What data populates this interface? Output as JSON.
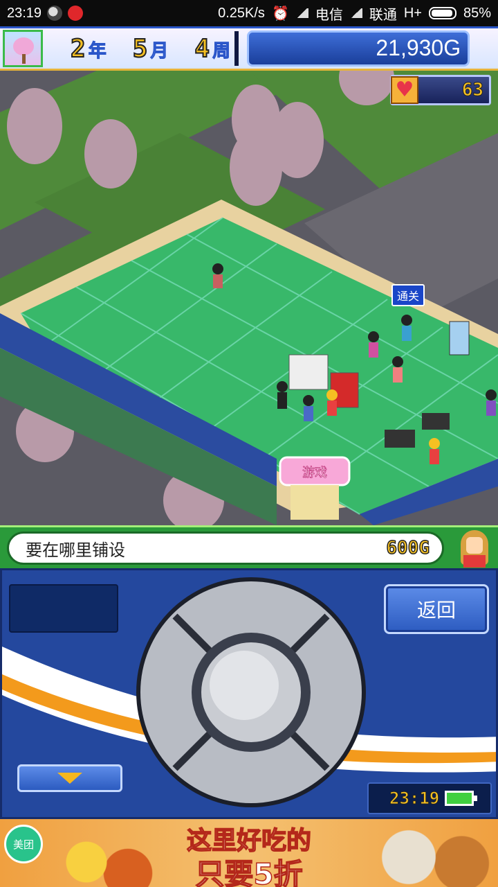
{
  "statusbar": {
    "time": "23:19",
    "speed": "0.25K/s",
    "carrier1": "电信",
    "carrier2": "联通",
    "network": "H+",
    "battery": "85%"
  },
  "hud": {
    "year_num": "2",
    "year_unit": "年",
    "month_num": "5",
    "month_unit": "月",
    "week_num": "4",
    "week_unit": "周",
    "money": "21,930G",
    "hearts": "63"
  },
  "game": {
    "clear_tag": "通关",
    "shop_sign": "游戏"
  },
  "message": {
    "prompt": "要在哪里铺设",
    "cost": "600G"
  },
  "controls": {
    "back_label": "返回",
    "clock": "23:19"
  },
  "ad": {
    "logo": "美团",
    "line1": "这里好吃的",
    "line2": "只要5折"
  }
}
